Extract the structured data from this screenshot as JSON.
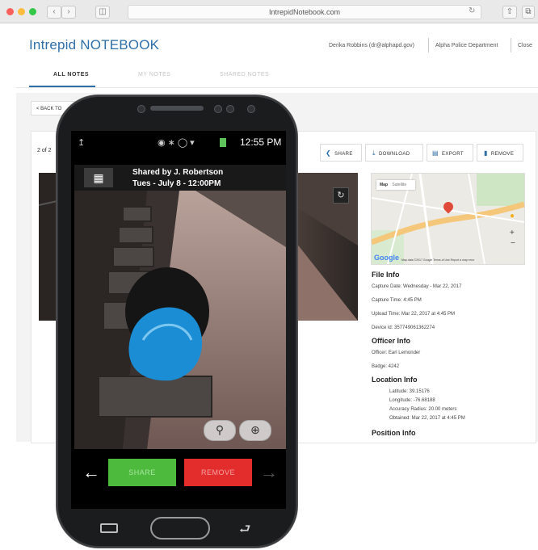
{
  "browser": {
    "url": "IntrepidNotebook.com",
    "traffic_colors": [
      "#fc605c",
      "#fdbc40",
      "#34c84a"
    ]
  },
  "header": {
    "brand": "Intrepid NOTEBOOK",
    "user": "Derika Robbins (dr@alphapd.gov)",
    "department": "Alpha Police Department",
    "close_label": "Close"
  },
  "tabs": [
    {
      "label": "ALL NOTES",
      "active": true
    },
    {
      "label": "MY NOTES",
      "active": false
    },
    {
      "label": "SHARED NOTES",
      "active": false
    }
  ],
  "main": {
    "back_label": "< BACK TO",
    "pager": "2 of 2",
    "actions": [
      {
        "label": "SHARE",
        "icon": "share-icon"
      },
      {
        "label": "DOWNLOAD",
        "icon": "download-icon"
      },
      {
        "label": "EXPORT",
        "icon": "export-icon"
      },
      {
        "label": "REMOVE",
        "icon": "trash-icon"
      }
    ]
  },
  "map": {
    "tab_map": "Map",
    "tab_satellite": "Satellite",
    "google": "Google",
    "footer": "Map data ©2017 Google  Terms of Use  Report a map error"
  },
  "file_info": {
    "heading": "File Info",
    "capture_date": "Capture Date: Wednesday - Mar 22, 2017",
    "capture_time": "Capture Time: 4:45 PM",
    "upload_time": "Upload Time: Mar 22, 2017 at 4:45 PM",
    "device_id": "Device id: 357749061362274"
  },
  "officer_info": {
    "heading": "Officer Info",
    "officer": "Officer: Earl Lemonder",
    "badge": "Badge: 4242"
  },
  "location_info": {
    "heading": "Location Info",
    "latitude": "Latitude: 39.15176",
    "longitude": "Longitude: -76.68188",
    "accuracy": "Accuracy Radius: 20.00 meters",
    "obtained": "Obtained: Mar 22, 2017 at 4:45 PM"
  },
  "position_info": {
    "heading": "Position Info"
  },
  "phone": {
    "time": "12:55 PM",
    "shared_by": "Shared by J. Robertson",
    "shared_date": "Tues - July 8 - 12:00PM",
    "share_label": "SHARE",
    "remove_label": "REMOVE",
    "share_color": "#4dba3d",
    "remove_color": "#e32d2d"
  }
}
